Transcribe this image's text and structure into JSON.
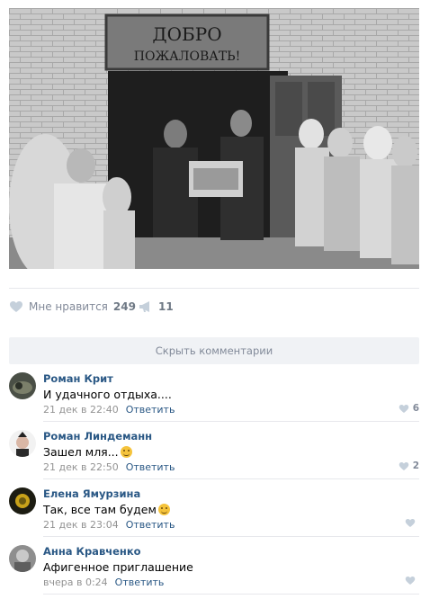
{
  "photo": {
    "sign_line1": "ДОБРО",
    "sign_line2": "ПОЖАЛОВАТЬ!"
  },
  "actions": {
    "like_label": "Мне нравится",
    "like_count": "249",
    "share_count": "11"
  },
  "hide_comments_label": "Скрыть комментарии",
  "comments": [
    {
      "author": "Роман Крит",
      "text": "И удачного отдыха....",
      "date": "21 дек в 22:40",
      "reply": "Ответить",
      "likes": "6",
      "emoji": false
    },
    {
      "author": "Роман Линдеманн",
      "text": "Зашел мля...",
      "date": "21 дек в 22:50",
      "reply": "Ответить",
      "likes": "2",
      "emoji": true
    },
    {
      "author": "Елена Ямурзина",
      "text": "Так, все там будем",
      "date": "21 дек в 23:04",
      "reply": "Ответить",
      "likes": "",
      "emoji": true
    },
    {
      "author": "Анна Кравченко",
      "text": "Афигенное приглашение",
      "date": "вчера в 0:24",
      "reply": "Ответить",
      "likes": "",
      "emoji": false
    }
  ],
  "colors": {
    "link": "#2a5885",
    "muted": "#828a99",
    "separator": "#e7e8ec",
    "bar_bg": "#f0f2f5"
  }
}
